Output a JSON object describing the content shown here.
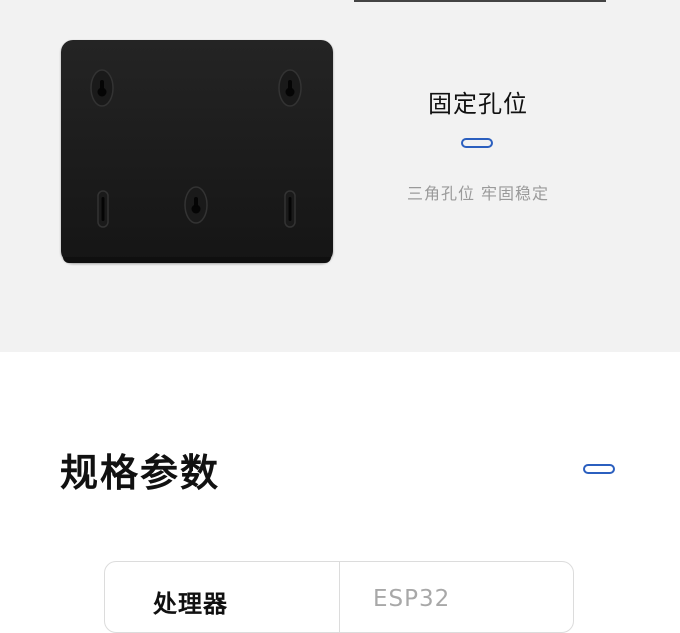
{
  "feature": {
    "title": "固定孔位",
    "subtitle": "三角孔位 牢固稳定",
    "accent_color": "#2b5fbf",
    "image_icon": "mounting-plate-icon"
  },
  "specs": {
    "heading": "规格参数",
    "rows": [
      {
        "label": "处理器",
        "value": "ESP32"
      }
    ]
  }
}
